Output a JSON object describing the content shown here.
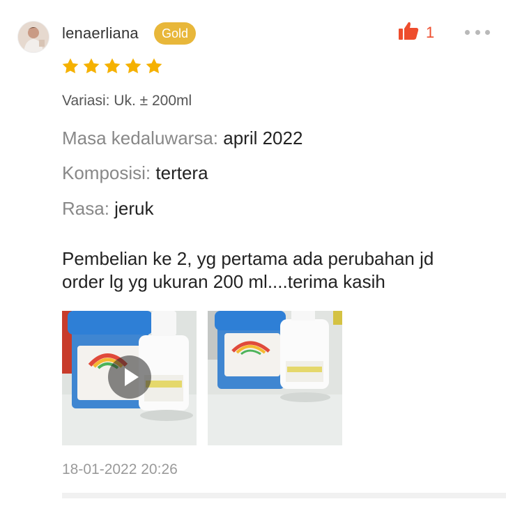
{
  "user": {
    "name": "lenaerliana",
    "badge": "Gold"
  },
  "likes": {
    "count": "1"
  },
  "rating": {
    "stars": 5,
    "max": 5,
    "color": "#f5b100"
  },
  "variant": "Variasi: Uk. ± 200ml",
  "attributes": [
    {
      "label": "Masa kedaluwarsa:",
      "value": "april 2022"
    },
    {
      "label": "Komposisi:",
      "value": "tertera"
    },
    {
      "label": "Rasa:",
      "value": "jeruk"
    }
  ],
  "comment": "Pembelian ke 2, yg pertama ada perubahan jd order lg yg ukuran 200 ml....terima kasih",
  "media": [
    {
      "type": "video",
      "icon": "play-icon"
    },
    {
      "type": "image"
    }
  ],
  "timestamp": "18-01-2022 20:26",
  "colors": {
    "accent": "#ee4d2d",
    "gold_badge": "#e8b73a"
  }
}
